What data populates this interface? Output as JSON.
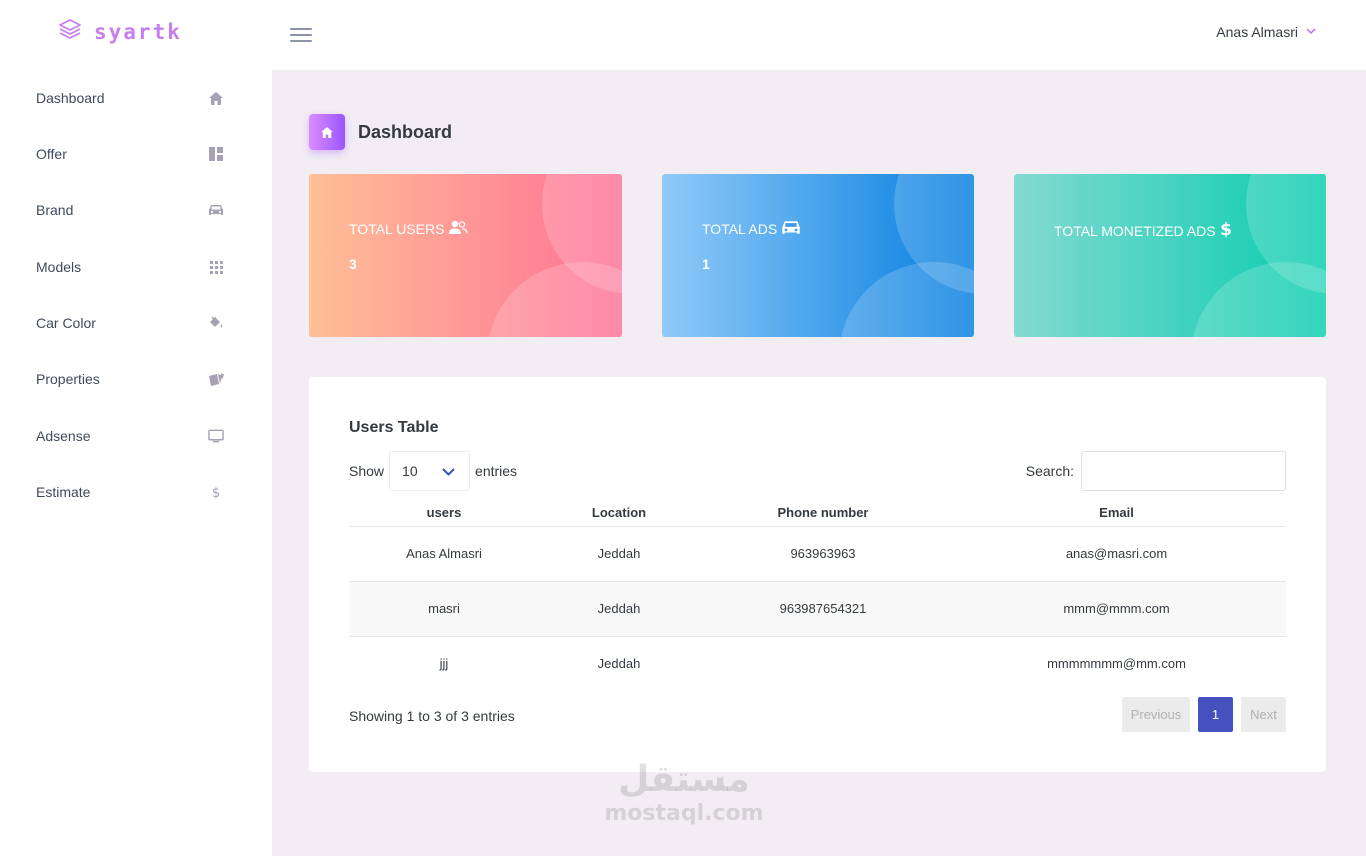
{
  "brand": {
    "name": "syartk"
  },
  "header": {
    "user_name": "Anas Almasri"
  },
  "sidebar": {
    "items": [
      {
        "label": "Dashboard",
        "icon": "home-icon"
      },
      {
        "label": "Offer",
        "icon": "layout-icon"
      },
      {
        "label": "Brand",
        "icon": "car-icon"
      },
      {
        "label": "Models",
        "icon": "grid-icon"
      },
      {
        "label": "Car Color",
        "icon": "paint-bucket-icon"
      },
      {
        "label": "Properties",
        "icon": "cards-icon"
      },
      {
        "label": "Adsense",
        "icon": "monitor-icon"
      },
      {
        "label": "Estimate",
        "icon": "dollar-icon"
      }
    ]
  },
  "page": {
    "title": "Dashboard"
  },
  "stats": [
    {
      "title": "TOTAL USERS",
      "value": "3",
      "icon": "users-icon"
    },
    {
      "title": "TOTAL ADS",
      "value": "1",
      "icon": "car-icon"
    },
    {
      "title": "TOTAL MONETIZED ADS",
      "value": "",
      "icon": "dollar-icon"
    }
  ],
  "users_table": {
    "title": "Users Table",
    "show_label": "Show",
    "entries_value": "10",
    "entries_label": "entries",
    "search_label": "Search:",
    "search_value": "",
    "columns": [
      "users",
      "Location",
      "Phone number",
      "Email"
    ],
    "rows": [
      [
        "Anas Almasri",
        "Jeddah",
        "963963963",
        "anas@masri.com"
      ],
      [
        "masri",
        "Jeddah",
        "963987654321",
        "mmm@mmm.com"
      ],
      [
        "jjj",
        "Jeddah",
        "",
        "mmmmmmm@mm.com"
      ]
    ],
    "info": "Showing 1 to 3 of 3 entries",
    "pagination": {
      "previous": "Previous",
      "current": "1",
      "next": "Next"
    }
  },
  "watermark": {
    "arabic": "مستقل",
    "latin": "mostaql.com"
  },
  "colors": {
    "accent": "#b66dff",
    "pagination_active": "#4650be",
    "card_users": [
      "#ffbf96",
      "#fe7096"
    ],
    "card_ads": [
      "#90caf9",
      "#047edf"
    ],
    "card_monetized": [
      "#84d9d2",
      "#07cdae"
    ]
  }
}
